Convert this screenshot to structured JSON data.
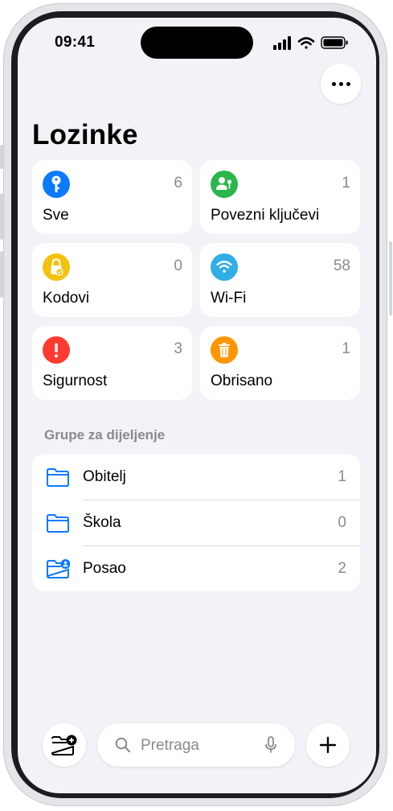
{
  "status_bar": {
    "time": "09:41"
  },
  "page": {
    "title": "Lozinke"
  },
  "categories": [
    {
      "label": "Sve",
      "count": "6",
      "icon": "key-icon",
      "color": "#0a7aff"
    },
    {
      "label": "Povezni ključevi",
      "count": "1",
      "icon": "passkey-person-icon",
      "color": "#2bb64c"
    },
    {
      "label": "Kodovi",
      "count": "0",
      "icon": "lock-check-icon",
      "color": "#f4c20d"
    },
    {
      "label": "Wi-Fi",
      "count": "58",
      "icon": "wifi-icon",
      "color": "#32ade6"
    },
    {
      "label": "Sigurnost",
      "count": "3",
      "icon": "exclamation-icon",
      "color": "#ff3b30"
    },
    {
      "label": "Obrisano",
      "count": "1",
      "icon": "trash-icon",
      "color": "#ff9500"
    }
  ],
  "shared_groups": {
    "header": "Grupe za dijeljenje",
    "items": [
      {
        "label": "Obitelj",
        "count": "1",
        "icon": "folder-icon"
      },
      {
        "label": "Škola",
        "count": "0",
        "icon": "folder-icon"
      },
      {
        "label": "Posao",
        "count": "2",
        "icon": "shared-folder-icon"
      }
    ]
  },
  "bottom_bar": {
    "search_placeholder": "Pretraga",
    "new_group_icon": "folder-add-icon",
    "add_icon": "plus-icon",
    "mic_icon": "microphone-icon"
  },
  "accent_color": "#0a7aff"
}
